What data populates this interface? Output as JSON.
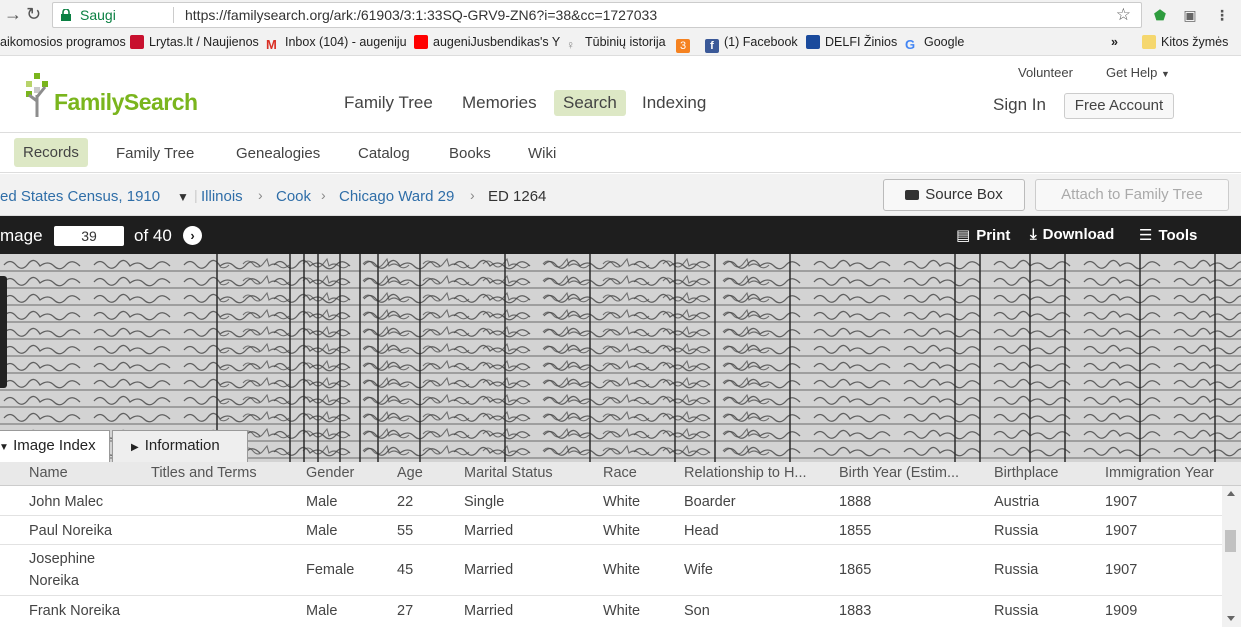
{
  "browser": {
    "secure_label": "Saugi",
    "url": "https://familysearch.org/ark:/61903/3:1:33SQ-GRV9-ZN6?i=38&cc=1727033",
    "ext_badge": "0"
  },
  "bookmarks": [
    {
      "label": "aikomosios programos",
      "color": "#ffffff"
    },
    {
      "label": "Lrytas.lt / Naujienos",
      "color": "#c8102e"
    },
    {
      "label": "Inbox (104) - augeniju",
      "color": "#ffffff"
    },
    {
      "label": "augeniJusbendikas's Y",
      "color": "#ff0000"
    },
    {
      "label": "Tūbinių istorija",
      "color": "#ffffff"
    },
    {
      "label": "",
      "color": "#f58220"
    },
    {
      "label": "(1) Facebook",
      "color": "#3b5998"
    },
    {
      "label": "DELFI Žinios",
      "color": "#1a4a9c"
    },
    {
      "label": "Google",
      "color": "#ffffff"
    },
    {
      "label": "»",
      "color": ""
    },
    {
      "label": "Kitos žymės",
      "color": "#f5d76e"
    }
  ],
  "header": {
    "logo_text": "FamilySearch",
    "nav": [
      "Family Tree",
      "Memories",
      "Search",
      "Indexing"
    ],
    "active_nav": "Search",
    "volunteer": "Volunteer",
    "get_help": "Get Help",
    "sign_in": "Sign In",
    "free_account": "Free Account"
  },
  "subnav": [
    "Records",
    "Family Tree",
    "Genealogies",
    "Catalog",
    "Books",
    "Wiki"
  ],
  "breadcrumb": {
    "collection": "ed States Census, 1910",
    "state": "Illinois",
    "county": "Cook",
    "ward": "Chicago Ward 29",
    "district": "ED 1264",
    "source_box": "Source Box",
    "attach": "Attach to Family Tree"
  },
  "image_toolbar": {
    "image_label": "mage",
    "page_value": "39",
    "of_label": "of 40",
    "print": "Print",
    "download": "Download",
    "tools": "Tools"
  },
  "tabs": {
    "image_index": "Image Index",
    "information": "Information"
  },
  "table": {
    "columns": [
      "Name",
      "Titles and Terms",
      "Gender",
      "Age",
      "Marital Status",
      "Race",
      "Relationship to H...",
      "Birth Year (Estim...",
      "Birthplace",
      "Immigration Year"
    ],
    "rows": [
      {
        "name": "John Malec",
        "name2": "",
        "titles": "",
        "gender": "Male",
        "age": "22",
        "marital": "Single",
        "race": "White",
        "relationship": "Boarder",
        "birth_year": "1888",
        "birthplace": "Austria",
        "immigration": "1907"
      },
      {
        "name": "Paul Noreika",
        "name2": "",
        "titles": "",
        "gender": "Male",
        "age": "55",
        "marital": "Married",
        "race": "White",
        "relationship": "Head",
        "birth_year": "1855",
        "birthplace": "Russia",
        "immigration": "1907"
      },
      {
        "name": "Josephine",
        "name2": "Noreika",
        "titles": "",
        "gender": "Female",
        "age": "45",
        "marital": "Married",
        "race": "White",
        "relationship": "Wife",
        "birth_year": "1865",
        "birthplace": "Russia",
        "immigration": "1907"
      },
      {
        "name": "Frank Noreika",
        "name2": "",
        "titles": "",
        "gender": "Male",
        "age": "27",
        "marital": "Married",
        "race": "White",
        "relationship": "Son",
        "birth_year": "1883",
        "birthplace": "Russia",
        "immigration": "1909"
      }
    ]
  }
}
